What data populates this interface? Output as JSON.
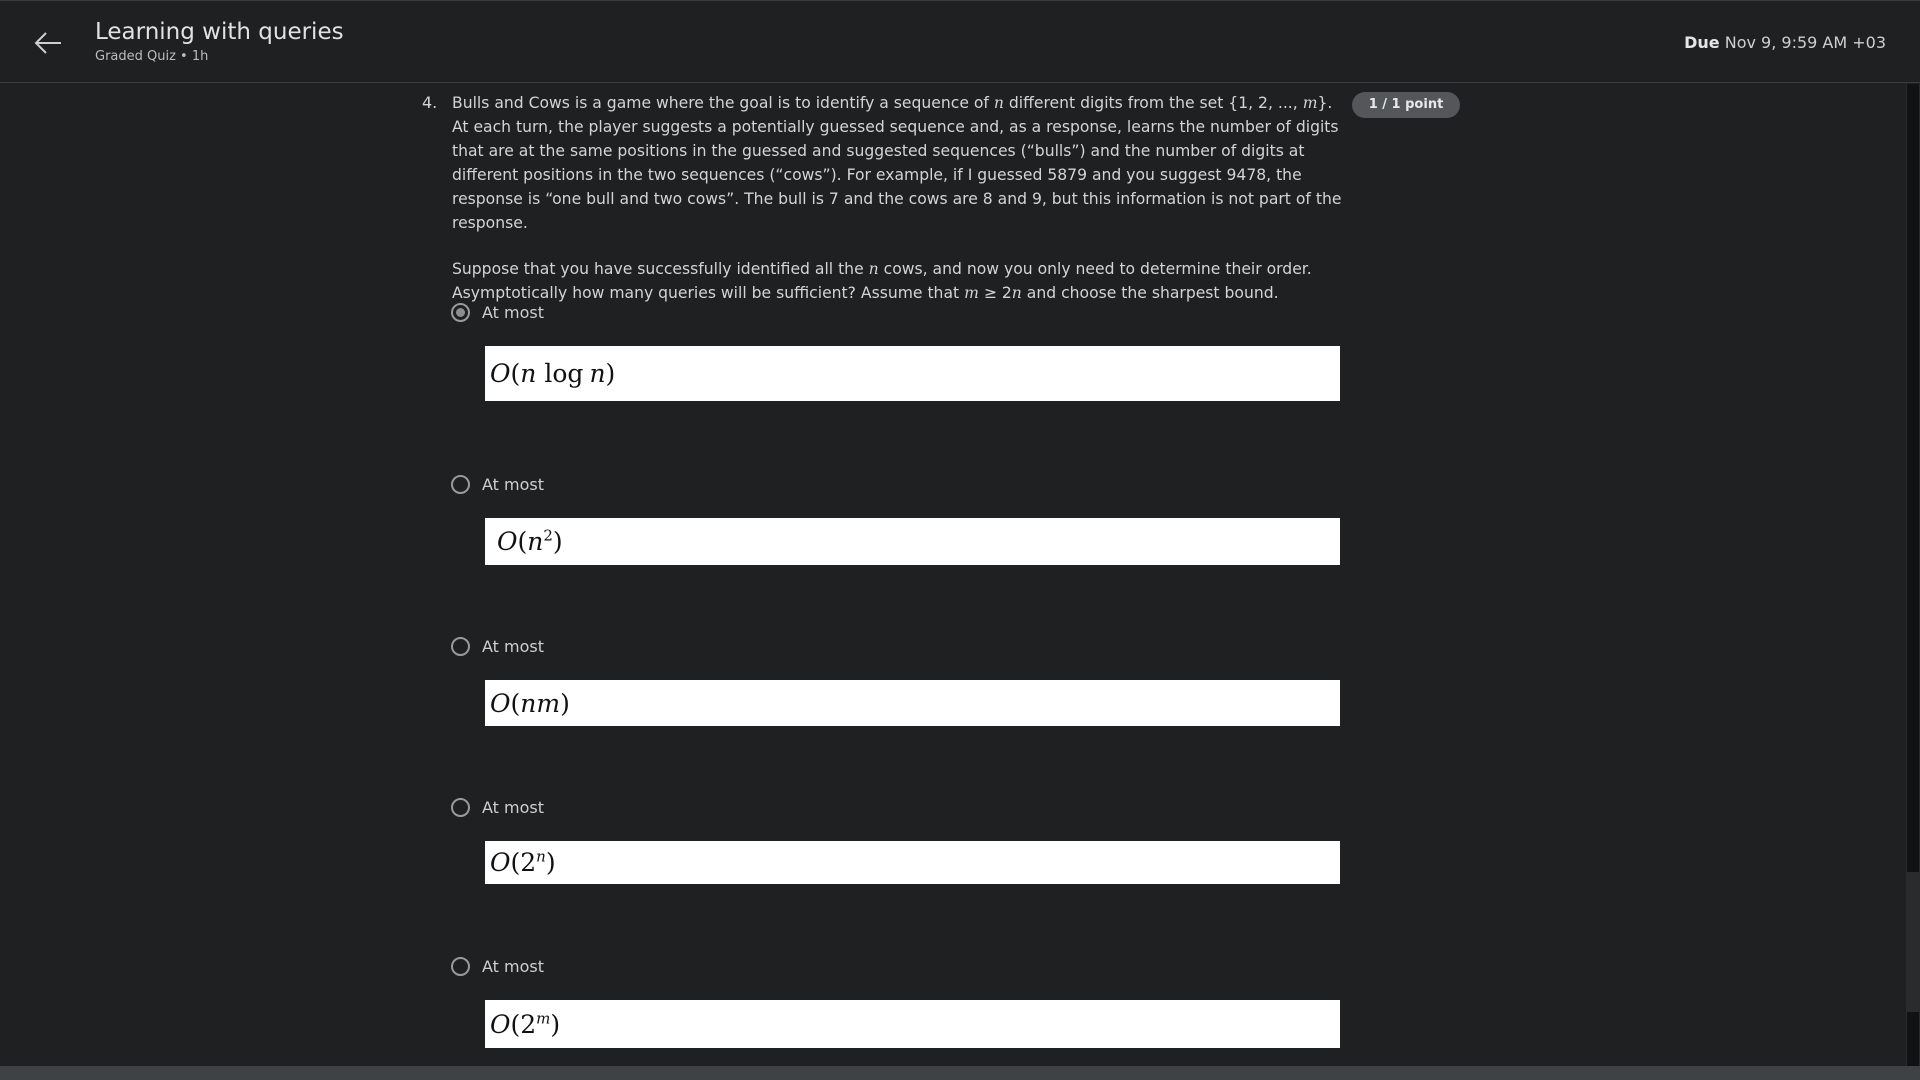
{
  "header": {
    "title": "Learning with queries",
    "subtitle": "Graded Quiz • 1h",
    "due_label": "Due",
    "due_value": "Nov 9, 9:59 AM +03"
  },
  "question": {
    "number": "4.",
    "points": "1 / 1 point",
    "para1_a": "Bulls and Cows is a game where the goal is to identify a sequence of ",
    "para1_n": "n",
    "para1_b": " different digits from the set {1, 2, ..., ",
    "para1_m": "m",
    "para1_c": "}. At each turn, the player suggests a potentially guessed sequence and, as a response, learns the number of digits that are at the same positions in the guessed and suggested sequences (“bulls”) and the number of digits at different positions in the two sequences (“cows”). For example, if I guessed 5879 and you suggest 9478, the response is “one bull and two cows”. The bull is 7 and the cows are 8 and 9, but this information is not part of the response.",
    "para2_a": "Suppose that you have successfully identified all the ",
    "para2_n": "n",
    "para2_b": " cows, and now you only need to determine their order. Asymptotically how many queries will be sufficient? Assume that ",
    "para2_m": "m",
    "para2_c": " ≥ 2",
    "para2_n2": "n",
    "para2_d": " and choose the sharpest bound."
  },
  "options": [
    {
      "label": "At most",
      "selected": true,
      "formula": "O(n log n)"
    },
    {
      "label": "At most",
      "selected": false,
      "formula": "O(n^2)"
    },
    {
      "label": "At most",
      "selected": false,
      "formula": "O(nm)"
    },
    {
      "label": "At most",
      "selected": false,
      "formula": "O(2^n)"
    },
    {
      "label": "At most",
      "selected": false,
      "formula": "O(2^m)"
    }
  ],
  "math": {
    "O": "O",
    "open": "(",
    "close": ")",
    "n": "n",
    "m": "m",
    "log": "log",
    "two": "2",
    "sq": "2"
  },
  "icons": {
    "back": "arrow-left-icon",
    "radio_checked": "radio-checked-icon",
    "radio_unchecked": "radio-unchecked-icon"
  }
}
